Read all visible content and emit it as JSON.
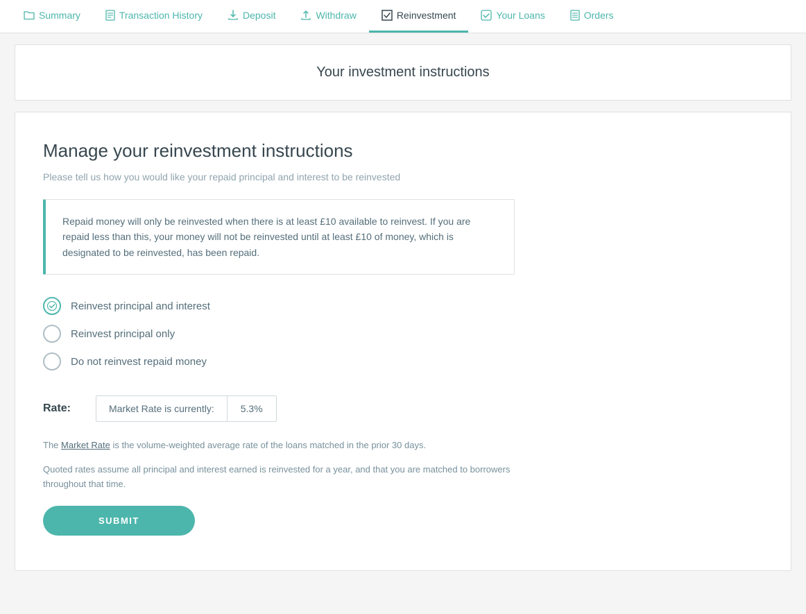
{
  "nav": {
    "items": [
      {
        "id": "summary",
        "label": "Summary",
        "icon": "folder",
        "active": false
      },
      {
        "id": "transaction-history",
        "label": "Transaction History",
        "icon": "doc",
        "active": false
      },
      {
        "id": "deposit",
        "label": "Deposit",
        "icon": "download",
        "active": false
      },
      {
        "id": "withdraw",
        "label": "Withdraw",
        "icon": "upload",
        "active": false
      },
      {
        "id": "reinvestment",
        "label": "Reinvestment",
        "icon": "square",
        "active": true
      },
      {
        "id": "your-loans",
        "label": "Your Loans",
        "icon": "checkbox",
        "active": false
      },
      {
        "id": "orders",
        "label": "Orders",
        "icon": "list",
        "active": false
      }
    ]
  },
  "page": {
    "header_title": "Your investment instructions",
    "section_title": "Manage your reinvestment instructions",
    "section_subtitle": "Please tell us how you would like your repaid principal and interest to be reinvested",
    "info_box_text": "Repaid money will only be reinvested when there is at least £10 available to reinvest. If you are repaid less than this, your money will not be reinvested until at least £10 of money, which is designated to be reinvested, has been repaid.",
    "radio_options": [
      {
        "id": "principal-and-interest",
        "label": "Reinvest principal and interest",
        "checked": true
      },
      {
        "id": "principal-only",
        "label": "Reinvest principal only",
        "checked": false
      },
      {
        "id": "do-not-reinvest",
        "label": "Do not reinvest repaid money",
        "checked": false
      }
    ],
    "rate_label": "Rate:",
    "rate_market_label": "Market Rate is currently:",
    "rate_value": "5.3%",
    "footnote1_prefix": "The ",
    "footnote1_link": "Market Rate",
    "footnote1_suffix": " is the volume-weighted average rate of the loans matched in the prior 30 days.",
    "footnote2": "Quoted rates assume all principal and interest earned is reinvested for a year, and that you are matched to borrowers throughout that time.",
    "submit_label": "SUBMIT"
  }
}
